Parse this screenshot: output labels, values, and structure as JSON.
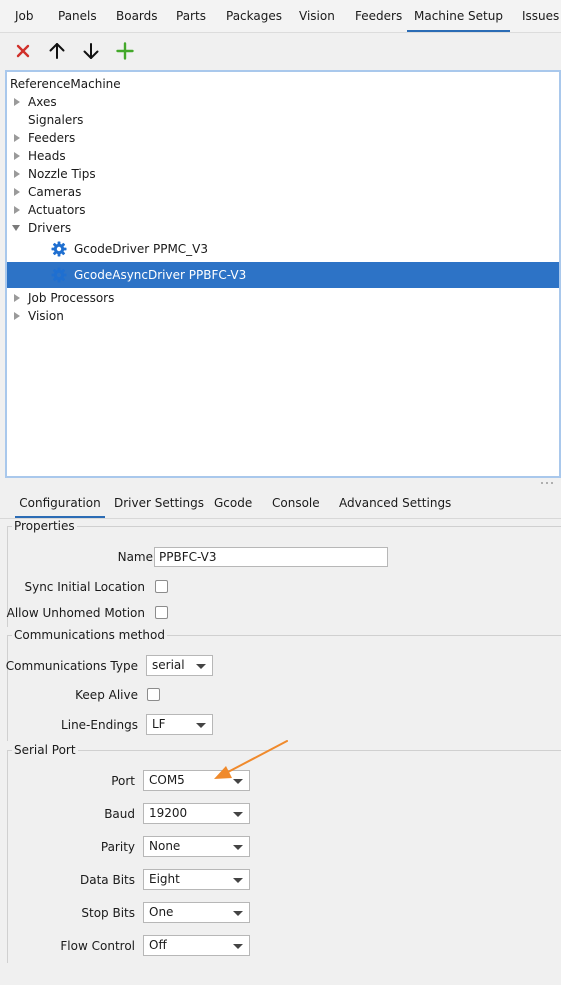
{
  "top_tabs": [
    "Job",
    "Panels",
    "Boards",
    "Parts",
    "Packages",
    "Vision",
    "Feeders",
    "Machine Setup",
    "Issues &"
  ],
  "toolbar": {
    "buttons": [
      {
        "icon": "delete-x-icon",
        "color": "#d0302a"
      },
      {
        "icon": "arrow-up-icon",
        "color": "#111111"
      },
      {
        "icon": "arrow-down-icon",
        "color": "#111111"
      },
      {
        "icon": "add-plus-icon",
        "color": "#43a82a"
      }
    ]
  },
  "tree": {
    "root": "ReferenceMachine",
    "items": [
      "Axes",
      "Signalers",
      "Feeders",
      "Heads",
      "Nozzle Tips",
      "Cameras",
      "Actuators",
      "Drivers"
    ],
    "drivers": [
      "GcodeDriver PPMC_V3",
      "GcodeAsyncDriver PPBFC-V3"
    ],
    "after": [
      "Job Processors",
      "Vision"
    ],
    "selected": "GcodeAsyncDriver PPBFC-V3",
    "selection_color": "#2d73c6"
  },
  "bottom_tabs": [
    "Configuration",
    "Driver Settings",
    "Gcode",
    "Console",
    "Advanced Settings"
  ],
  "properties": {
    "title": "Properties",
    "name_label": "Name",
    "name_value": "PPBFC-V3",
    "sync_label": "Sync Initial Location",
    "unhomed_label": "Allow Unhomed Motion"
  },
  "comms": {
    "title": "Communications method",
    "type_label": "Communications Type",
    "type_value": "serial",
    "keepalive_label": "Keep Alive",
    "lineend_label": "Line-Endings",
    "lineend_value": "LF"
  },
  "serial": {
    "title": "Serial Port",
    "port_label": "Port",
    "port_value": "COM5",
    "baud_label": "Baud",
    "baud_value": "19200",
    "parity_label": "Parity",
    "parity_value": "None",
    "databits_label": "Data Bits",
    "databits_value": "Eight",
    "stopbits_label": "Stop Bits",
    "stopbits_value": "One",
    "flow_label": "Flow Control",
    "flow_value": "Off"
  },
  "annotation_color": "#f08a2c"
}
